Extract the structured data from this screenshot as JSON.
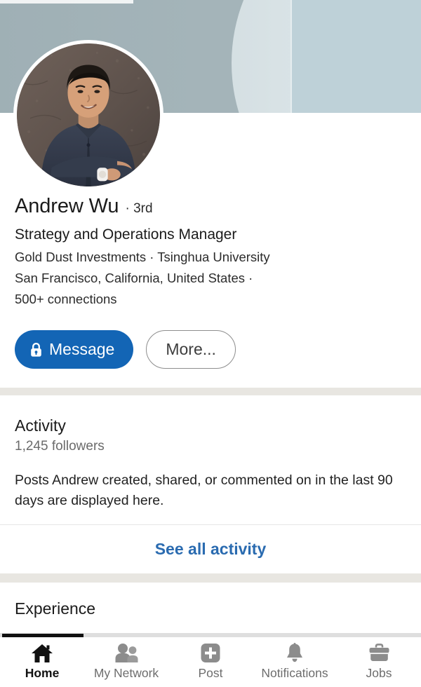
{
  "colors": {
    "banner_primary": "#a4b4b9",
    "banner_light": "#bed1d8",
    "banner_arc": "#d9e3e6",
    "primary_button": "#1365b5",
    "link_blue": "#2a6bb0",
    "page_background": "#f3f2ef",
    "divider_band": "#e8e6e1",
    "active_nav": "#111111",
    "inactive_nav": "#6d6d6d"
  },
  "banner": {
    "icon": "cover-photo"
  },
  "profile": {
    "avatar_icon": "profile-photo",
    "name": "Andrew Wu",
    "degree": "· 3rd",
    "headline": "Strategy and Operations Manager",
    "company_and_school": "Gold Dust Investments · Tsinghua University",
    "location": "San Francisco, California, United States ·",
    "connections": "500+ connections",
    "actions": {
      "message_label": "Message",
      "message_icon": "lock-icon",
      "more_label": "More..."
    }
  },
  "activity": {
    "title": "Activity",
    "followers": "1,245 followers",
    "empty_state": "Posts Andrew created, shared, or commented on in the last 90 days are displayed here.",
    "see_all_label": "See all activity"
  },
  "experience": {
    "title": "Experience"
  },
  "bottom_nav": {
    "items": [
      {
        "label": "Home",
        "icon": "home-icon",
        "active": true
      },
      {
        "label": "My Network",
        "icon": "people-icon",
        "active": false
      },
      {
        "label": "Post",
        "icon": "plus-square-icon",
        "active": false
      },
      {
        "label": "Notifications",
        "icon": "bell-icon",
        "active": false
      },
      {
        "label": "Jobs",
        "icon": "briefcase-icon",
        "active": false
      }
    ]
  }
}
